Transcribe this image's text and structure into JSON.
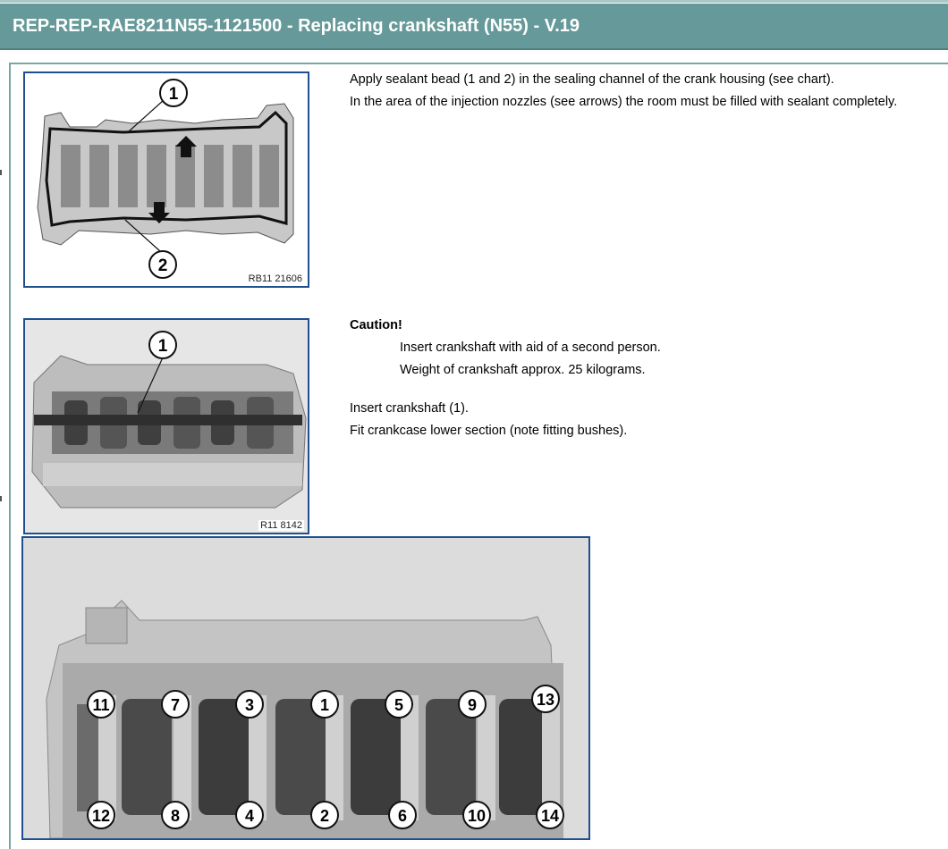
{
  "header": {
    "title": "REP-REP-RAE8211N55-1121500 - Replacing crankshaft (N55) - V.19"
  },
  "steps": [
    {
      "figure_label": "RB11 21606",
      "callouts": [
        "1",
        "2"
      ],
      "lines": [
        "Apply sealant bead  (1 and 2) in the sealing channel of the crank housing (see chart).",
        "In the area of the injection nozzles (see arrows) the room must be filled with sealant completely."
      ]
    },
    {
      "figure_label": "R11 8142",
      "callouts": [
        "1"
      ],
      "caution_title": "Caution!",
      "caution_lines": [
        "Insert crankshaft with aid of a second person.",
        "Weight of crankshaft approx. 25 kilograms."
      ],
      "lines": [
        "Insert crankshaft (1).",
        "Fit crankcase lower section (note fitting bushes)."
      ]
    },
    {
      "callouts_top": [
        "11",
        "7",
        "3",
        "1",
        "5",
        "9",
        "13"
      ],
      "callouts_bottom": [
        "12",
        "8",
        "4",
        "2",
        "6",
        "10",
        "14"
      ]
    }
  ]
}
